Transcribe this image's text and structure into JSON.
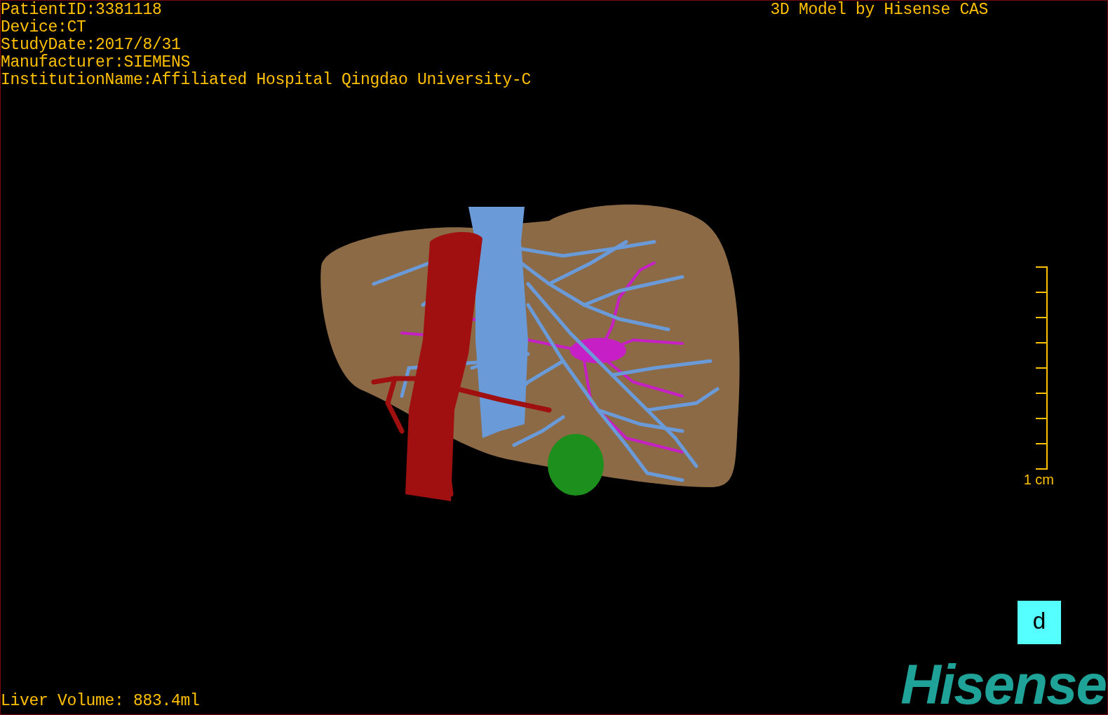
{
  "patient_info": [
    "PatientID:3381118",
    "Device:CT",
    "StudyDate:2017/8/31",
    "Manufacturer:SIEMENS",
    "InstitutionName:Affiliated Hospital Qingdao University-C"
  ],
  "title": "3D Model by Hisense CAS",
  "scale_bar": {
    "label": "1 cm"
  },
  "orientation_cube": {
    "label": "d"
  },
  "liver_volume": "Liver Volume: 883.4ml",
  "logo": "Hisense"
}
